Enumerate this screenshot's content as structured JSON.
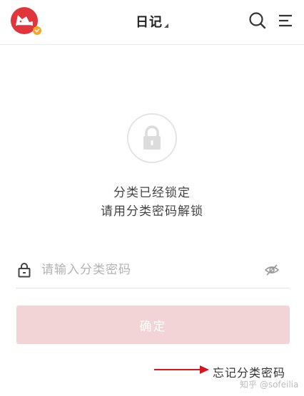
{
  "header": {
    "title": "日记",
    "avatar_icon": "cat-avatar-icon",
    "search_icon": "search-icon",
    "menu_icon": "menu-icon"
  },
  "lock_screen": {
    "icon": "lock-icon",
    "message_line1": "分类已经锁定",
    "message_line2": "请用分类密码解锁"
  },
  "password_field": {
    "placeholder": "请输入分类密码",
    "value": ""
  },
  "confirm_button": {
    "label": "确定"
  },
  "forgot_link": {
    "label": "忘记分类密码"
  },
  "watermark": {
    "text": "知乎 @sofeilia"
  },
  "colors": {
    "brand_red": "#e0353b",
    "confirm_disabled": "#f3d4d6",
    "annotation_arrow": "#d9151b"
  }
}
